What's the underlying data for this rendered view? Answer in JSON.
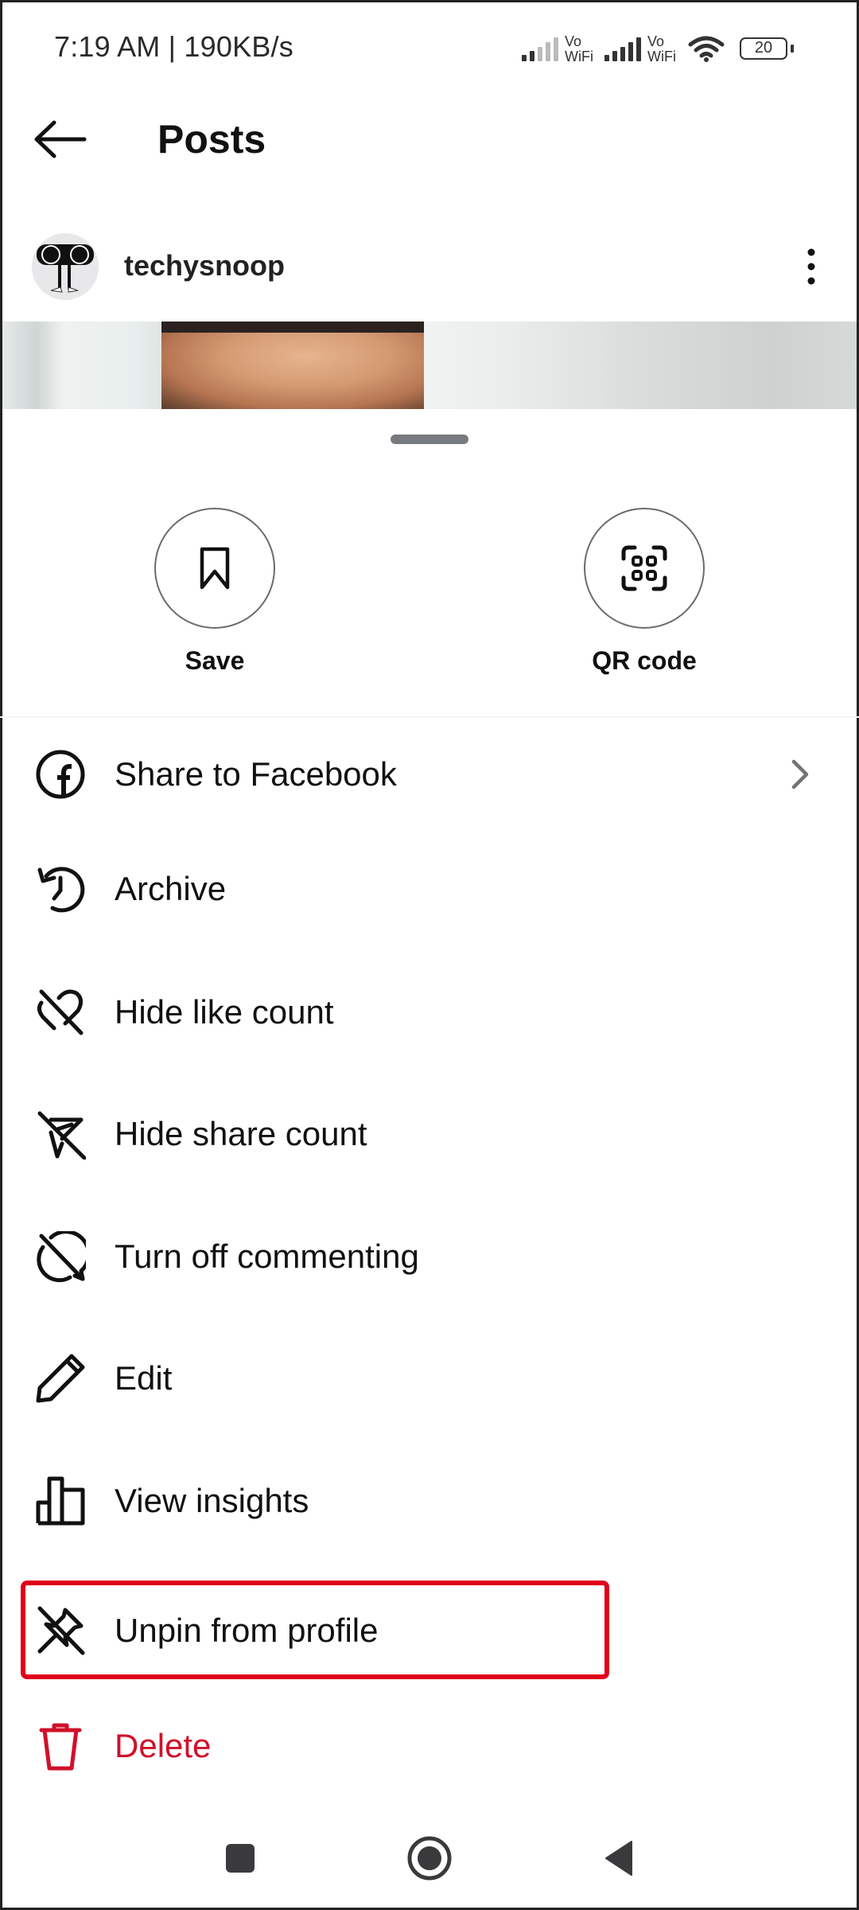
{
  "status_bar": {
    "time": "7:19 AM | 190KB/s",
    "sim1_label_top": "Vo",
    "sim1_label_bottom": "WiFi",
    "sim2_label_top": "Vo",
    "sim2_label_bottom": "WiFi",
    "battery_level": "20",
    "icons": [
      "signal-weak-icon",
      "vowifi-icon",
      "signal-full-icon",
      "vowifi-icon",
      "wifi-icon",
      "battery-icon"
    ]
  },
  "header": {
    "title": "Posts",
    "back_icon": "arrow-left-icon"
  },
  "post": {
    "username": "techysnoop",
    "more_icon": "more-vertical-icon"
  },
  "sheet": {
    "quick_actions": [
      {
        "label": "Save",
        "icon": "bookmark-icon"
      },
      {
        "label": "QR code",
        "icon": "qr-scan-icon"
      }
    ],
    "menu": [
      {
        "label": "Share to Facebook",
        "icon": "facebook-icon",
        "has_chevron": true
      },
      {
        "label": "Archive",
        "icon": "archive-history-icon"
      },
      {
        "label": "Hide like count",
        "icon": "heart-off-icon"
      },
      {
        "label": "Hide share count",
        "icon": "send-off-icon"
      },
      {
        "label": "Turn off commenting",
        "icon": "comment-off-icon"
      },
      {
        "label": "Edit",
        "icon": "pencil-icon"
      },
      {
        "label": "View insights",
        "icon": "bar-chart-icon"
      },
      {
        "label": "Unpin from profile",
        "icon": "unpin-icon",
        "highlighted": true
      },
      {
        "label": "Delete",
        "icon": "trash-icon",
        "danger": true
      }
    ]
  },
  "colors": {
    "danger": "#d0102a",
    "highlight_box": "#e0001b",
    "text": "#111111",
    "chevron": "#737373"
  },
  "nav_bar": {
    "buttons": [
      "recents-square-icon",
      "home-circle-icon",
      "back-triangle-icon"
    ]
  }
}
